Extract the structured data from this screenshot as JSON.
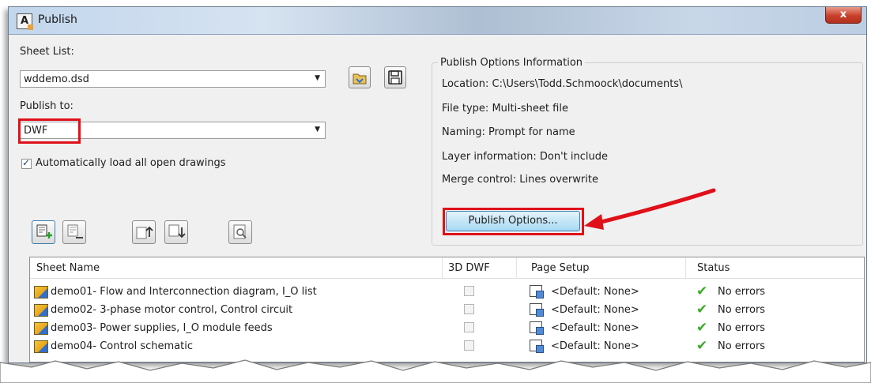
{
  "window": {
    "title": "Publish",
    "close_label": "x"
  },
  "sheet_list": {
    "label": "Sheet List:",
    "value": "wddemo.dsd"
  },
  "publish_to": {
    "label": "Publish to:",
    "value": "DWF"
  },
  "auto_load": {
    "label": "Automatically load all open drawings",
    "checked": true
  },
  "options_info": {
    "title": "Publish Options Information",
    "location": "Location:  C:\\Users\\Todd.Schmoock\\documents\\",
    "file_type": "File type: Multi-sheet file",
    "naming": "Naming: Prompt for name",
    "layer_info": "Layer information: Don't include",
    "merge_control": "Merge control: Lines overwrite",
    "button_label": "Publish Options..."
  },
  "table": {
    "headers": [
      "Sheet Name",
      "3D DWF",
      "Page Setup",
      "Status"
    ],
    "rows": [
      {
        "name": "demo01- Flow and Interconnection diagram, I_O list",
        "page_setup": "<Default: None>",
        "status": "No errors"
      },
      {
        "name": "demo02- 3-phase motor control, Control circuit",
        "page_setup": "<Default: None>",
        "status": "No errors"
      },
      {
        "name": "demo03- Power supplies, I_O module feeds",
        "page_setup": "<Default: None>",
        "status": "No errors"
      },
      {
        "name": "demo04- Control schematic",
        "page_setup": "<Default: None>",
        "status": "No errors"
      }
    ]
  },
  "colors": {
    "highlight": "#e0101a",
    "status_ok": "#3bab2a",
    "title_bar": "#c2d6ec"
  }
}
